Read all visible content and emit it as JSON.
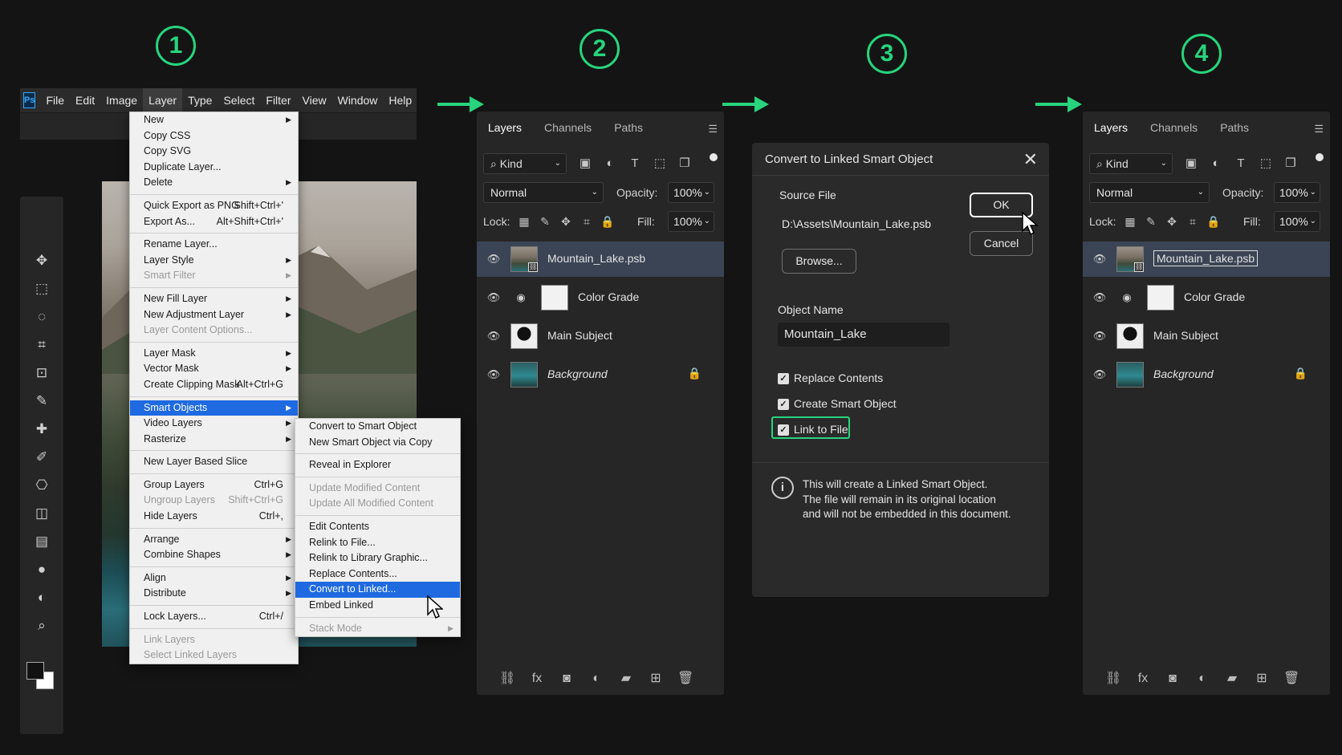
{
  "steps": [
    "1",
    "2",
    "3",
    "4"
  ],
  "accent_color": "#27d47d",
  "photoshop": {
    "logo": "Ps",
    "menubar": [
      "File",
      "Edit",
      "Image",
      "Layer",
      "Type",
      "Select",
      "Filter",
      "View",
      "Window",
      "Help"
    ],
    "active_menu": "Layer",
    "tools": [
      "move-icon",
      "marquee-icon",
      "lasso-icon",
      "crop-icon",
      "frame-icon",
      "eyedropper-icon",
      "healing-brush-icon",
      "brush-icon",
      "clone-stamp-icon",
      "eraser-icon",
      "gradient-icon",
      "blur-icon",
      "dodge-icon",
      "zoom-icon"
    ]
  },
  "layer_menu": {
    "items": [
      {
        "label": "New",
        "sub": true
      },
      {
        "label": "Copy CSS"
      },
      {
        "label": "Copy SVG"
      },
      {
        "label": "Duplicate Layer..."
      },
      {
        "label": "Delete",
        "sub": true
      },
      {
        "sep": true
      },
      {
        "label": "Quick Export as PNG",
        "shortcut": "Shift+Ctrl+'"
      },
      {
        "label": "Export As...",
        "shortcut": "Alt+Shift+Ctrl+'"
      },
      {
        "sep": true
      },
      {
        "label": "Rename Layer..."
      },
      {
        "label": "Layer Style",
        "sub": true
      },
      {
        "label": "Smart Filter",
        "sub": true,
        "disabled": true
      },
      {
        "sep": true
      },
      {
        "label": "New Fill Layer",
        "sub": true
      },
      {
        "label": "New Adjustment Layer",
        "sub": true
      },
      {
        "label": "Layer Content Options...",
        "disabled": true
      },
      {
        "sep": true
      },
      {
        "label": "Layer Mask",
        "sub": true
      },
      {
        "label": "Vector Mask",
        "sub": true
      },
      {
        "label": "Create Clipping Mask",
        "shortcut": "Alt+Ctrl+G"
      },
      {
        "sep": true
      },
      {
        "label": "Smart Objects",
        "sub": true,
        "selected": true
      },
      {
        "label": "Video Layers",
        "sub": true
      },
      {
        "label": "Rasterize",
        "sub": true
      },
      {
        "sep": true
      },
      {
        "label": "New Layer Based Slice"
      },
      {
        "sep": true
      },
      {
        "label": "Group Layers",
        "shortcut": "Ctrl+G"
      },
      {
        "label": "Ungroup Layers",
        "shortcut": "Shift+Ctrl+G",
        "disabled": true
      },
      {
        "label": "Hide Layers",
        "shortcut": "Ctrl+,"
      },
      {
        "sep": true
      },
      {
        "label": "Arrange",
        "sub": true
      },
      {
        "label": "Combine Shapes",
        "sub": true
      },
      {
        "sep": true
      },
      {
        "label": "Align",
        "sub": true
      },
      {
        "label": "Distribute",
        "sub": true
      },
      {
        "sep": true
      },
      {
        "label": "Lock Layers...",
        "shortcut": "Ctrl+/"
      },
      {
        "sep": true
      },
      {
        "label": "Link Layers",
        "disabled": true
      },
      {
        "label": "Select Linked Layers",
        "disabled": true
      }
    ]
  },
  "smart_objects_menu": {
    "items": [
      {
        "label": "Convert to Smart Object"
      },
      {
        "label": "New Smart Object via Copy"
      },
      {
        "sep": true
      },
      {
        "label": "Reveal in Explorer"
      },
      {
        "sep": true
      },
      {
        "label": "Update Modified Content",
        "disabled": true
      },
      {
        "label": "Update All Modified Content",
        "disabled": true
      },
      {
        "sep": true
      },
      {
        "label": "Edit Contents"
      },
      {
        "label": "Relink to File..."
      },
      {
        "label": "Relink to Library Graphic..."
      },
      {
        "label": "Replace Contents..."
      },
      {
        "label": "Convert to Linked...",
        "selected": true
      },
      {
        "label": "Embed Linked"
      },
      {
        "sep": true
      },
      {
        "label": "Stack Mode",
        "sub": true,
        "disabled": true
      }
    ]
  },
  "layers_panel": {
    "tabs": [
      "Layers",
      "Channels",
      "Paths"
    ],
    "kind": "Kind",
    "blend_mode": "Normal",
    "opacity_label": "Opacity:",
    "opacity": "100%",
    "lock_label": "Lock:",
    "fill_label": "Fill:",
    "fill": "100%",
    "layers": [
      {
        "name": "Mountain_Lake.psb",
        "selected": true,
        "smart": true
      },
      {
        "name": "Color Grade",
        "adjustment": true
      },
      {
        "name": "Main Subject"
      },
      {
        "name": "Background",
        "italic": true,
        "locked": true
      }
    ]
  },
  "dialog": {
    "title": "Convert to Linked Smart Object",
    "source_file_label": "Source File",
    "source_file": "D:\\Assets\\Mountain_Lake.psb",
    "browse": "Browse...",
    "ok": "OK",
    "cancel": "Cancel",
    "object_name_label": "Object Name",
    "object_name": "Mountain_Lake",
    "checkboxes": [
      "Replace Contents",
      "Create Smart Object",
      "Link to File"
    ],
    "info": [
      "This will create a Linked Smart Object.",
      "The file will remain in its original location",
      "and will not be embedded in this document."
    ]
  }
}
